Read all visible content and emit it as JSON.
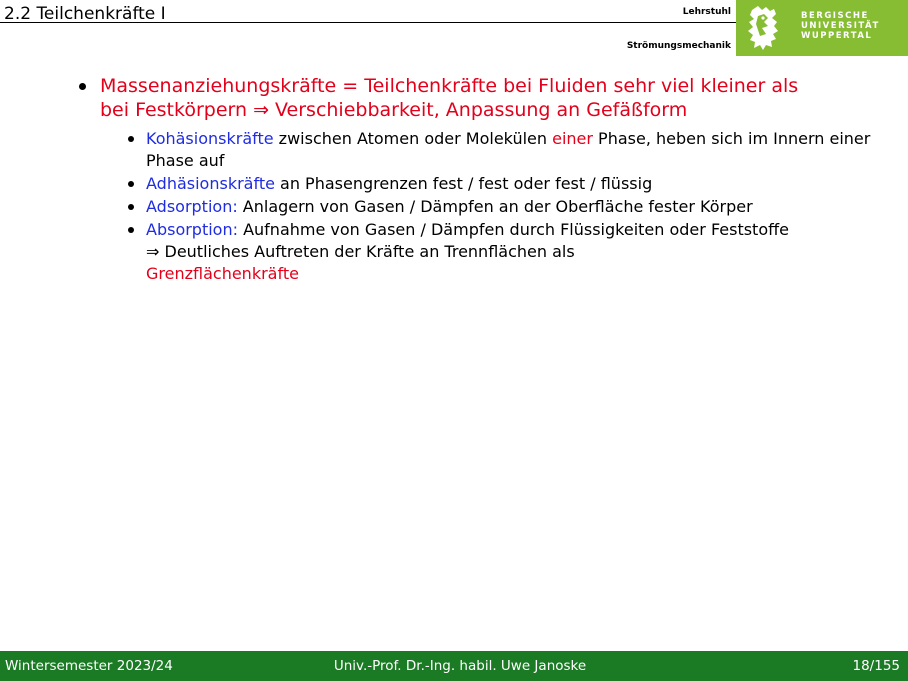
{
  "header": {
    "title": "2.2 Teilchenkräfte I",
    "chair_line1": "Lehrstuhl",
    "chair_line2": "Strömungsmechanik",
    "university_lines": [
      "BERGISCHE",
      "UNIVERSITÄT",
      "WUPPERTAL"
    ]
  },
  "content": {
    "main_bullet": {
      "line1": "Massenanziehungskräfte = Teilchenkräfte bei Fluiden sehr viel kleiner als",
      "line2": "bei Festkörpern ⇒ Verschiebbarkeit, Anpassung an Gefäßform"
    },
    "sub_bullets": [
      {
        "term": "Kohäsionskräfte",
        "text_a": " zwischen Atomen oder Molekülen ",
        "highlight": "einer",
        "text_b": " Phase, heben sich im Innern einer Phase auf"
      },
      {
        "term": "Adhäsionskräfte",
        "text": " an Phasengrenzen fest / fest oder fest / flüssig"
      },
      {
        "term": "Adsorption:",
        "text": " Anlagern von Gasen / Dämpfen an der Oberfläche fester Körper"
      },
      {
        "term": "Absorption:",
        "text": " Aufnahme von Gasen / Dämpfen durch Flüssigkeiten oder Feststoffe",
        "conclusion": "⇒ Deutliches Auftreten der Kräfte an Trennflächen als",
        "conclusion_highlight": "Grenzflächenkräfte"
      }
    ]
  },
  "footer": {
    "left": "Wintersemester 2023/24",
    "center": "Univ.-Prof. Dr.-Ing. habil. Uwe Janoske",
    "right": "18/155"
  },
  "colors": {
    "footer_bg": "#1b7a24",
    "logo_bg": "#86bd32",
    "emphasis_red": "#e3001b",
    "term_blue": "#1f2ce0"
  },
  "icons": {
    "logo": "bergische-lion-logo-icon"
  }
}
